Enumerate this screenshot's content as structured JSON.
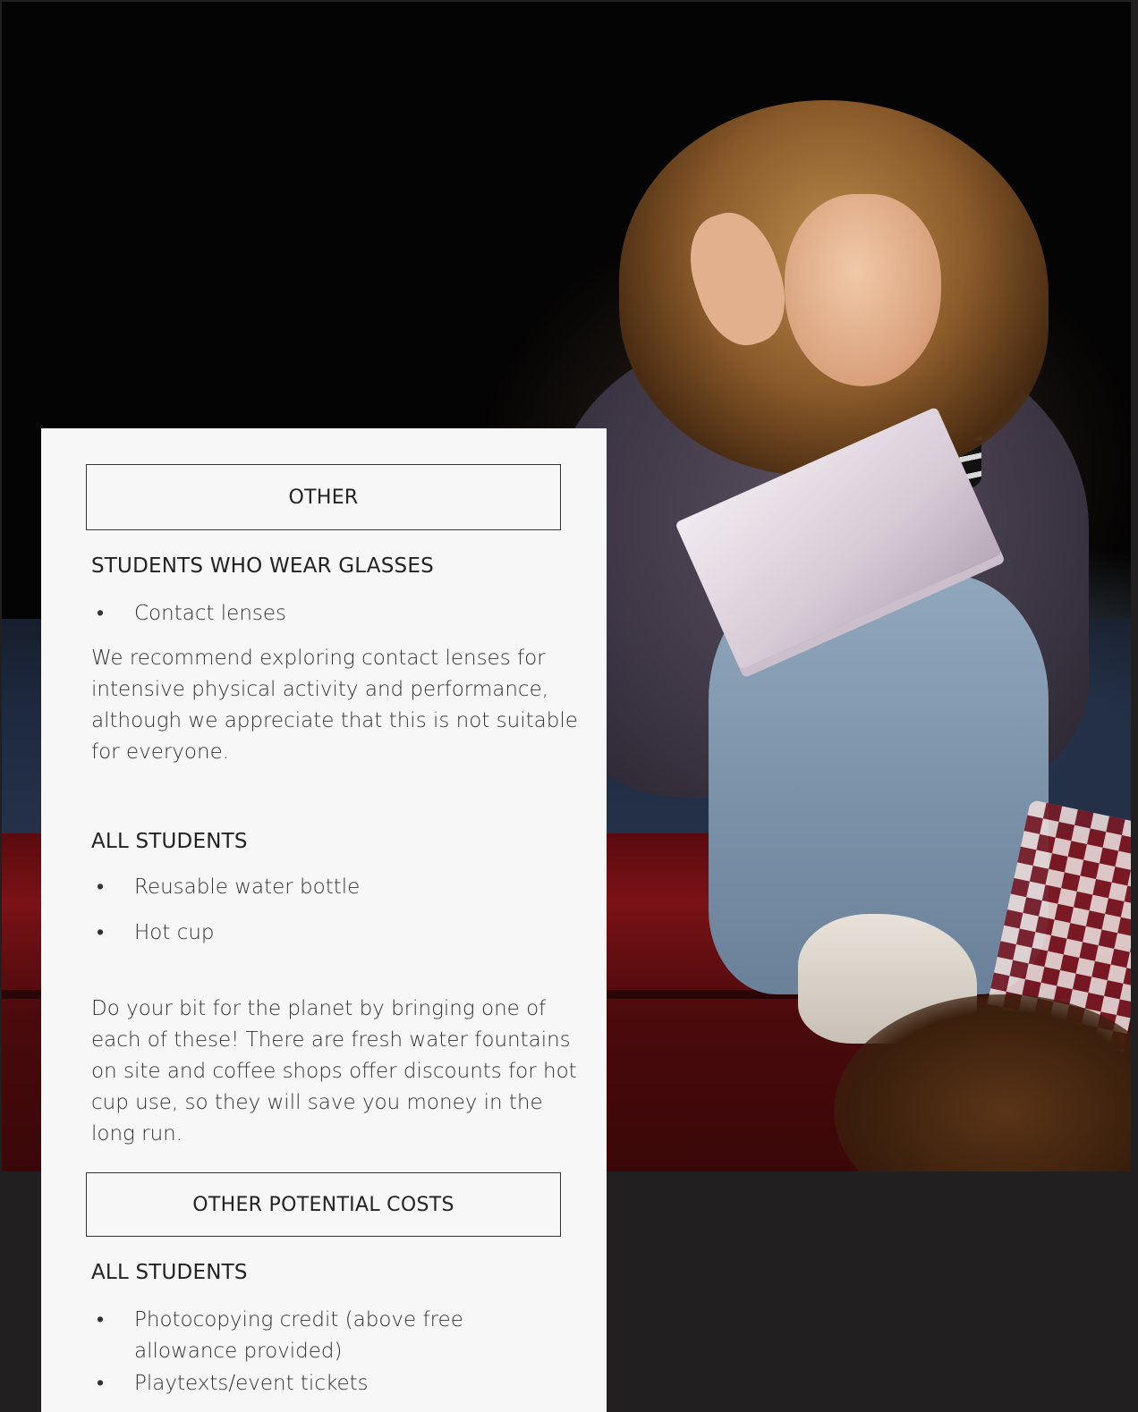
{
  "hero": {
    "image": "student-reading-script-on-stage"
  },
  "colors": {
    "page_background": "#221f20",
    "card_background": "#f8f7f7",
    "text": "#2a2a2a",
    "box_border": "#333333"
  },
  "card": {
    "section_other": "OTHER",
    "glasses": {
      "heading": "STUDENTS WHO WEAR GLASSES",
      "bullet_marker": "•",
      "items": [
        "Contact lenses"
      ],
      "paragraph": "We recommend exploring contact lenses for intensive physical activity and performance, although we appreciate that this is not suitable for everyone."
    },
    "all_students_1": {
      "heading": "ALL STUDENTS",
      "items": [
        "Reusable water bottle",
        "Hot cup"
      ],
      "paragraph": "Do your bit for the planet by bringing one of each of these! There are fresh water fountains on site and coffee shops offer discounts for hot cup use, so they will save you money in the long run."
    },
    "section_costs": "OTHER POTENTIAL COSTS",
    "all_students_2": {
      "heading": "ALL STUDENTS",
      "items": [
        "Photocopying credit (above free allowance provided)",
        "Playtexts/event tickets"
      ]
    }
  }
}
